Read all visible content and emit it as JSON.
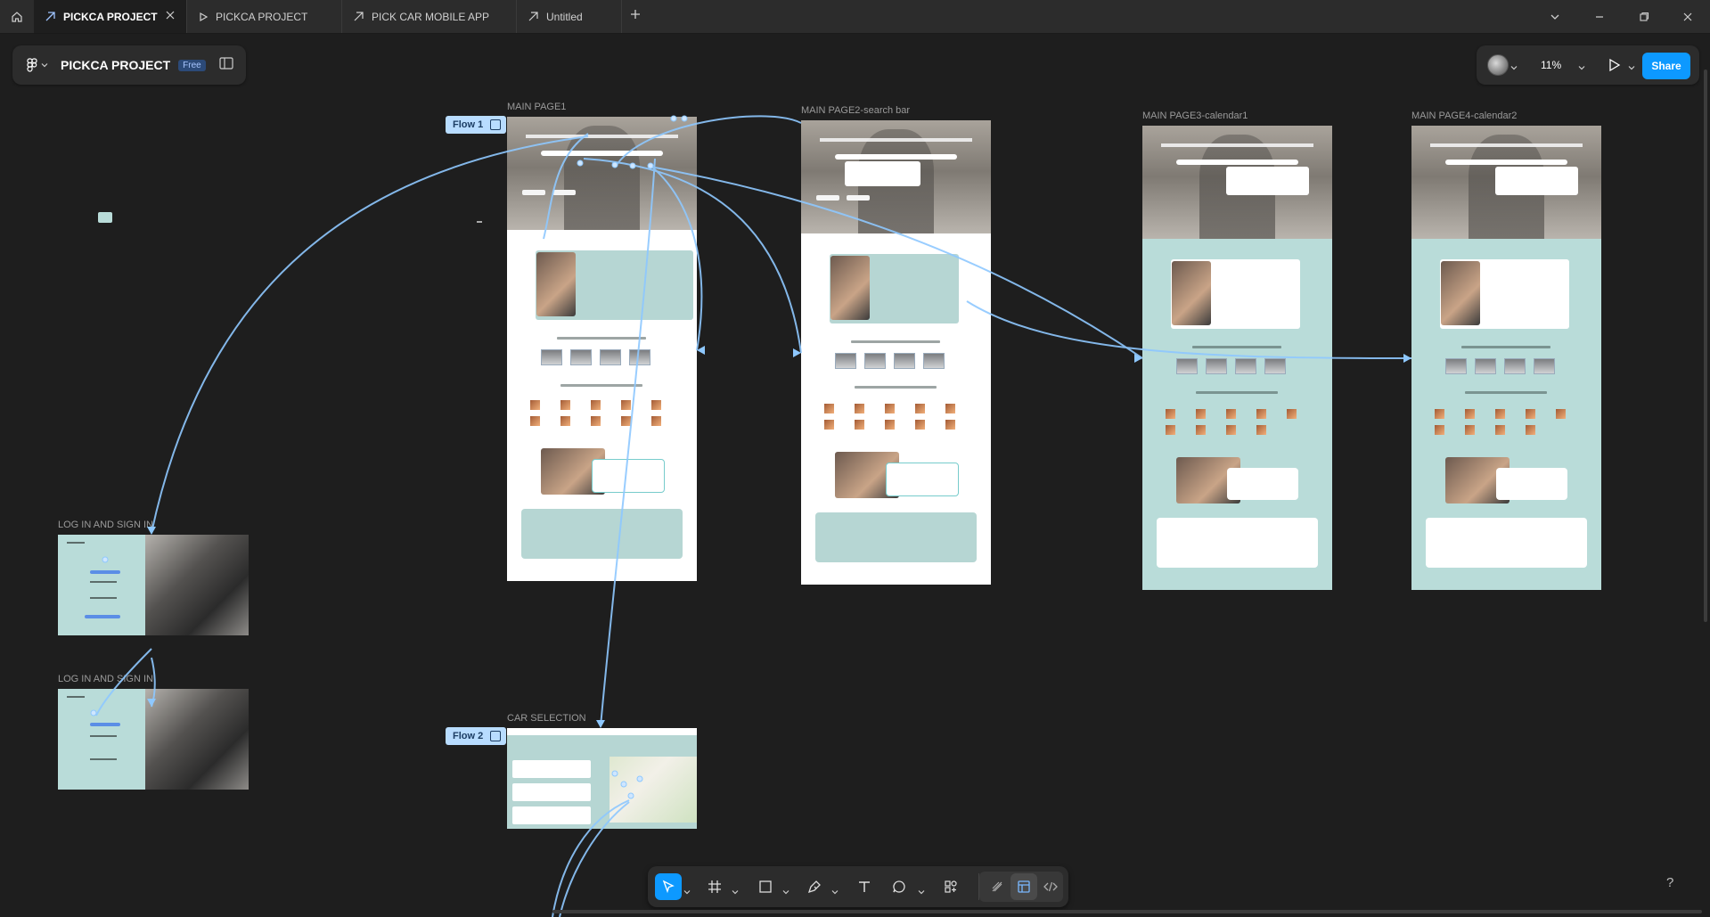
{
  "tabs": [
    {
      "label": "PICKCA PROJECT",
      "active": true
    },
    {
      "label": "PICKCA PROJECT",
      "active": false
    },
    {
      "label": "PICK CAR MOBILE APP",
      "active": false
    },
    {
      "label": "Untitled",
      "active": false
    }
  ],
  "file": {
    "name": "PICKCA PROJECT",
    "plan_badge": "Free"
  },
  "zoom": "11%",
  "share_label": "Share",
  "frames": {
    "main1": "MAIN PAGE1",
    "main2": "MAIN PAGE2-search bar",
    "main3": "MAIN PAGE3-calendar1",
    "main4": "MAIN PAGE4-calendar2",
    "login1": "LOG IN AND SIGN IN",
    "login2": "LOG IN AND SIGN IN",
    "carsel": "CAR SELECTION"
  },
  "flows": {
    "flow1": "Flow 1",
    "flow2": "Flow 2"
  },
  "help": "?",
  "icons": [
    "home-icon",
    "prototype-icon",
    "close-icon",
    "plus-icon",
    "chevron-down-icon",
    "minimize-icon",
    "maximize-icon",
    "window-close-icon",
    "figma-menu-icon",
    "sidebar-toggle-icon",
    "play-icon",
    "move-tool-icon",
    "frame-tool-icon",
    "rectangle-tool-icon",
    "pen-tool-icon",
    "text-tool-icon",
    "comment-tool-icon",
    "actions-icon",
    "draw-mode-icon",
    "design-mode-icon",
    "dev-mode-icon"
  ],
  "colors": {
    "canvas": "#1e1e1e",
    "panel": "#2c2c2c",
    "accent": "#0d99ff",
    "flow": "#b8dcff",
    "frame_teal": "#b6d6d3"
  }
}
